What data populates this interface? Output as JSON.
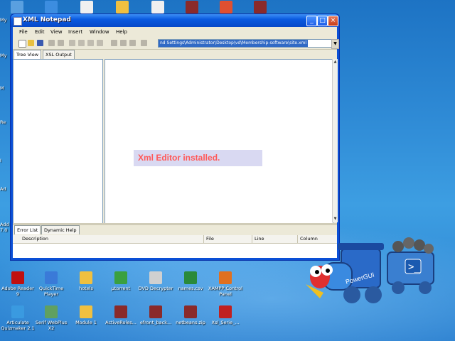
{
  "desktop": {
    "top_icons": [
      {
        "name": "top-icon-1",
        "color": "#5aa0e0"
      },
      {
        "name": "top-icon-2",
        "color": "#3c8de0"
      },
      {
        "name": "top-icon-3",
        "color": "#f0f0f0"
      },
      {
        "name": "top-icon-4",
        "color": "#f0c040"
      },
      {
        "name": "top-icon-5",
        "color": "#f0f0f0"
      },
      {
        "name": "top-icon-6",
        "color": "#8a2a2a"
      },
      {
        "name": "top-icon-7",
        "color": "#e05030"
      },
      {
        "name": "top-icon-8",
        "color": "#8a2a2a"
      }
    ],
    "left_edge_labels": [
      "My",
      "My",
      "M",
      "Re",
      "I",
      "Ad",
      "Add",
      "7.0"
    ],
    "bottom_icons_row1": [
      {
        "label": "Adobe Reader 9",
        "color": "#c01010"
      },
      {
        "label": "QuickTime Player",
        "color": "#3a7ad8"
      },
      {
        "label": "hotels",
        "color": "#f0c040"
      },
      {
        "label": "µtorrent",
        "color": "#3aa040"
      },
      {
        "label": "DVD Decrypter",
        "color": "#d0d0d0"
      },
      {
        "label": "names.csv",
        "color": "#2a8a3a"
      },
      {
        "label": "XAMPP Control Panel",
        "color": "#e07020"
      }
    ],
    "bottom_icons_row2": [
      {
        "label": "Articulate Quizmaker 2.1",
        "color": "#3a9ae0"
      },
      {
        "label": "Serif WebPlus X2",
        "color": "#60a060"
      },
      {
        "label": "Module 1",
        "color": "#f0c040"
      },
      {
        "label": "ActiveRoles...",
        "color": "#8a2a2a"
      },
      {
        "label": "efront_back...",
        "color": "#8a2a2a"
      },
      {
        "label": "netbeans.zip",
        "color": "#8a2a2a"
      },
      {
        "label": "Xsl_Serie_...",
        "color": "#c02020"
      }
    ]
  },
  "window": {
    "title": "XML Notepad",
    "controls": {
      "minimize": "_",
      "maximize": "□",
      "close": "×"
    },
    "menu": [
      "File",
      "Edit",
      "View",
      "Insert",
      "Window",
      "Help"
    ],
    "address": "nd Settings\\Administrator\\Desktop\\vd\\Membership-software\\site.xml",
    "tabs_top": [
      "Tree View",
      "XSL Output"
    ],
    "toast": "Xml Editor installed.",
    "tabs_bottom": [
      "Error List",
      "Dynamic Help"
    ],
    "error_columns": [
      "Description",
      "File",
      "Line",
      "Column"
    ]
  },
  "colors": {
    "titlebar": "#0a5ae0",
    "toast_text": "#ff5858",
    "toast_bg": "#d9d9f2"
  }
}
